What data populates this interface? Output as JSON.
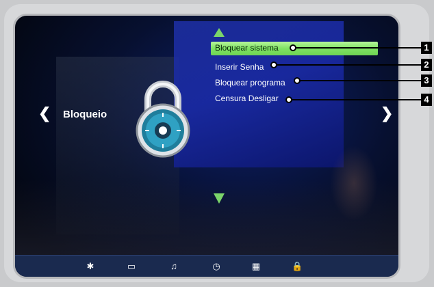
{
  "screen": {
    "section_title": "Bloqueio",
    "menu": [
      {
        "label": "Bloquear sistema",
        "selected": true
      },
      {
        "label": "Inserir Senha",
        "selected": false
      },
      {
        "label": "Bloquear programa",
        "selected": false
      },
      {
        "label": "Censura Desligar",
        "selected": false
      }
    ],
    "icons": {
      "left_arrow": "chevron-left-icon",
      "right_arrow": "chevron-right-icon",
      "up_arrow": "triangle-up-icon",
      "down_arrow": "triangle-down-icon",
      "lock": "padlock-icon"
    },
    "bottom_bar": [
      {
        "icon": "gear-icon",
        "glyph": "✱"
      },
      {
        "icon": "monitor-icon",
        "glyph": "▭"
      },
      {
        "icon": "music-icon",
        "glyph": "♫"
      },
      {
        "icon": "clock-icon",
        "glyph": "◷"
      },
      {
        "icon": "grid-icon",
        "glyph": "▦"
      },
      {
        "icon": "lock-icon",
        "glyph": "🔒"
      }
    ]
  },
  "callouts": [
    "1",
    "2",
    "3",
    "4"
  ],
  "colors": {
    "selection": "#7fe263",
    "arrow": "#7bd46a",
    "bar": "#1a2a4f",
    "frame": "#d7d8da"
  }
}
